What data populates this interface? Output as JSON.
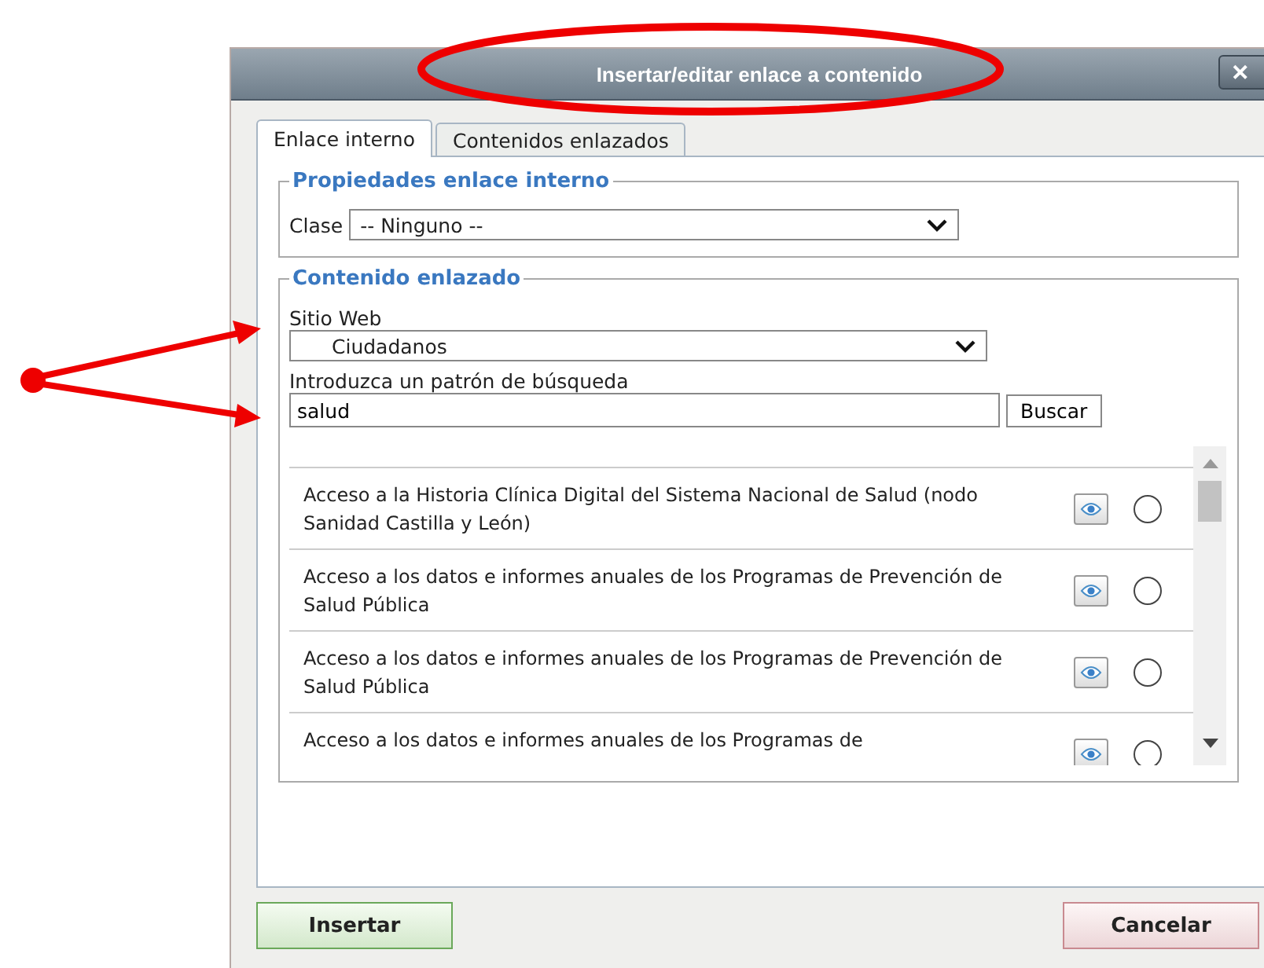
{
  "window": {
    "title": "Insertar/editar enlace a contenido",
    "close": "✕"
  },
  "tabs": [
    {
      "label": "Enlace interno",
      "selected": true
    },
    {
      "label": "Contenidos enlazados",
      "selected": false
    }
  ],
  "properties": {
    "legend": "Propiedades enlace interno",
    "class_label": "Clase",
    "class_value": "-- Ninguno --"
  },
  "linked": {
    "legend": "Contenido enlazado",
    "site_label": "Sitio Web",
    "site_value": "Ciudadanos",
    "search_label": "Introduzca un patrón de búsqueda",
    "search_value": "salud",
    "search_button": "Buscar",
    "results": [
      {
        "text": "Acceso a la Historia Clínica Digital del Sistema Nacional de Salud (nodo Sanidad Castilla y León)",
        "selected": false
      },
      {
        "text": "Acceso a los datos e informes anuales de los Programas de Prevención de Salud Pública",
        "selected": false
      },
      {
        "text": "Acceso a los datos e informes anuales de los Programas de Prevención de Salud Pública",
        "selected": false
      },
      {
        "text": "Acceso a los datos e informes anuales de los Programas de",
        "selected": false
      }
    ]
  },
  "buttons": [
    {
      "label": "Insertar",
      "kind": "ok"
    },
    {
      "label": "Cancelar",
      "kind": "cancel"
    }
  ]
}
